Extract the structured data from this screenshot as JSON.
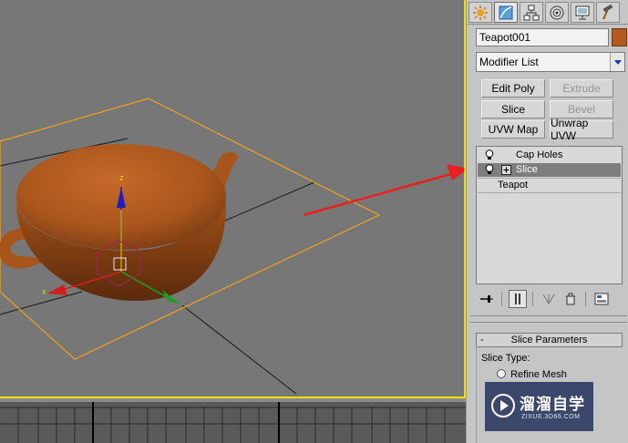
{
  "viewport": {
    "axis_labels": {
      "z": "z",
      "x": "x"
    },
    "colors": {
      "background": "#777777",
      "teapot": "#b55a1e",
      "slice_plane": "#f0a020",
      "border": "#f0e000",
      "arrow": "#e82020"
    }
  },
  "command_panel": {
    "tabs": [
      {
        "name": "create-tab",
        "icon": "create-icon"
      },
      {
        "name": "modify-tab",
        "icon": "modify-icon"
      },
      {
        "name": "hierarchy-tab",
        "icon": "hierarchy-icon"
      },
      {
        "name": "motion-tab",
        "icon": "motion-icon"
      },
      {
        "name": "display-tab",
        "icon": "display-icon"
      },
      {
        "name": "utilities-tab",
        "icon": "hammer-icon"
      }
    ],
    "object_name": "Teapot001",
    "object_color": "#b55a1e",
    "modifier_list": "Modifier List",
    "buttons": {
      "edit_poly": "Edit Poly",
      "extrude": "Extrude",
      "slice": "Slice",
      "bevel": "Bevel",
      "uvw_map": "UVW Map",
      "unwrap_uvw": "Unwrap UVW"
    },
    "stack": {
      "cap_holes": "Cap Holes",
      "slice": "Slice",
      "teapot": "Teapot"
    }
  },
  "slice_parameters": {
    "title": "Slice Parameters",
    "collapse": "-",
    "slice_type_label": "Slice Type:",
    "option_refine_mesh": "Refine Mesh"
  },
  "watermark": {
    "main": "溜溜自学",
    "sub": "ZIXUE.3D66.COM"
  }
}
